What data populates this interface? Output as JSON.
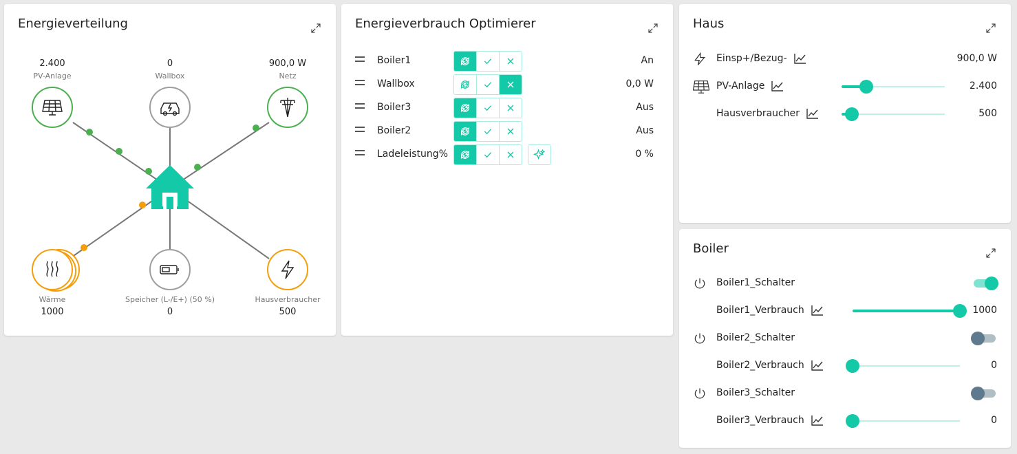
{
  "energy_flow": {
    "title": "Energieverteilung",
    "nodes": {
      "pv": {
        "value": "2.400",
        "label": "PV-Anlage"
      },
      "wallbox": {
        "value": "0",
        "label": "Wallbox"
      },
      "grid": {
        "value": "900,0 W",
        "label": "Netz"
      },
      "heat": {
        "value": "1000",
        "label": "Wärme"
      },
      "storage": {
        "value": "0",
        "label": "Speicher (L-/E+) (50 %)"
      },
      "house_consumer": {
        "value": "500",
        "label": "Hausverbraucher"
      }
    },
    "colors": {
      "green": "#4caf50",
      "orange": "#f59e0b",
      "gray": "#9e9e9e",
      "house": "#14c9a8"
    }
  },
  "optimizer": {
    "title": "Energieverbrauch Optimierer",
    "rows": [
      {
        "name": "Boiler1",
        "value": "An"
      },
      {
        "name": "Wallbox",
        "value": "0,0 W"
      },
      {
        "name": "Boiler3",
        "value": "Aus"
      },
      {
        "name": "Boiler2",
        "value": "Aus"
      },
      {
        "name": "Ladeleistung%",
        "value": "0 %"
      }
    ]
  },
  "haus": {
    "title": "Haus",
    "rows": [
      {
        "name": "Einsp+/Bezug-",
        "value": "900,0 W",
        "icon": "lightning-icon"
      },
      {
        "name": "PV-Anlage",
        "value": "2.400",
        "icon": "solar-panel-icon",
        "slider": 0.24
      },
      {
        "name": "Hausverbraucher",
        "value": "500",
        "slider": 0.1
      }
    ]
  },
  "boiler": {
    "title": "Boiler",
    "rows": [
      {
        "name": "Boiler1_Schalter",
        "type": "toggle",
        "on": true
      },
      {
        "name": "Boiler1_Verbrauch",
        "type": "slider",
        "value": "1000",
        "level": 1.0
      },
      {
        "name": "Boiler2_Schalter",
        "type": "toggle",
        "on": false
      },
      {
        "name": "Boiler2_Verbrauch",
        "type": "slider",
        "value": "0",
        "level": 0.0
      },
      {
        "name": "Boiler3_Schalter",
        "type": "toggle",
        "on": false
      },
      {
        "name": "Boiler3_Verbrauch",
        "type": "slider",
        "value": "0",
        "level": 0.0
      }
    ],
    "colors": {
      "accent": "#14c9a8",
      "off_thumb": "#5f7a8c",
      "off_track": "#b0bec5"
    }
  }
}
